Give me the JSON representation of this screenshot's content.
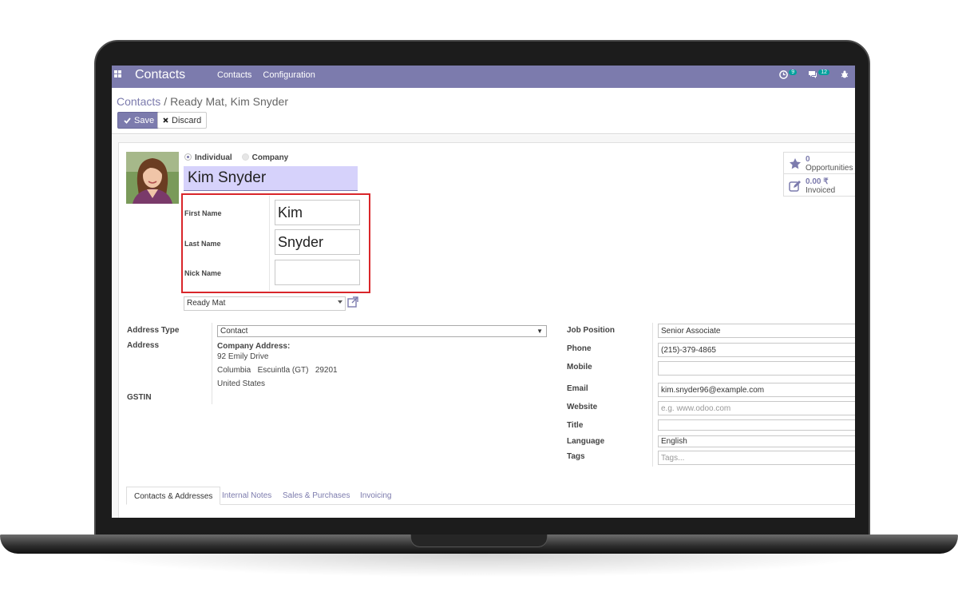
{
  "app": {
    "brand": "Contacts",
    "menu": [
      "Contacts",
      "Configuration"
    ],
    "systray": {
      "activity_count": "9",
      "message_count": "12"
    }
  },
  "breadcrumb": {
    "parent": "Contacts",
    "separator": "/",
    "current": "Ready Mat, Kim Snyder"
  },
  "buttons": {
    "save": "Save",
    "discard": "Discard"
  },
  "contact": {
    "type_options": [
      "Individual",
      "Company"
    ],
    "selected_type": "Individual",
    "display_name": "Kim Snyder",
    "first_name_label": "First Name",
    "first_name": "Kim",
    "last_name_label": "Last Name",
    "last_name": "Snyder",
    "nick_name_label": "Nick Name",
    "nick_name": "",
    "company": "Ready Mat"
  },
  "stats": {
    "opportunities": {
      "value": "0",
      "label": "Opportunities",
      "icon": "star-icon"
    },
    "invoiced": {
      "value": "0.00 ₹",
      "label": "Invoiced",
      "icon": "pencil-square-icon"
    }
  },
  "left_fields": {
    "address_type_label": "Address Type",
    "address_type": "Contact",
    "address_label": "Address",
    "company_address_heading": "Company Address:",
    "street": "92 Emily Drive",
    "city_line": "Columbia   Escuintla (GT)   29201",
    "country": "United States",
    "gstin_label": "GSTIN"
  },
  "right_fields": {
    "job_position_label": "Job Position",
    "job_position": "Senior Associate",
    "phone_label": "Phone",
    "phone": "(215)-379-4865",
    "mobile_label": "Mobile",
    "mobile": "",
    "email_label": "Email",
    "email": "kim.snyder96@example.com",
    "website_label": "Website",
    "website_placeholder": "e.g. www.odoo.com",
    "title_label": "Title",
    "title": "",
    "language_label": "Language",
    "language": "English",
    "tags_label": "Tags",
    "tags_placeholder": "Tags..."
  },
  "tabs": [
    "Contacts & Addresses",
    "Internal Notes",
    "Sales & Purchases",
    "Invoicing"
  ],
  "colors": {
    "brand": "#7c7bad",
    "name_field_bg": "#d6d2fb",
    "highlight": "#d9262a",
    "badge": "#00a09d"
  }
}
